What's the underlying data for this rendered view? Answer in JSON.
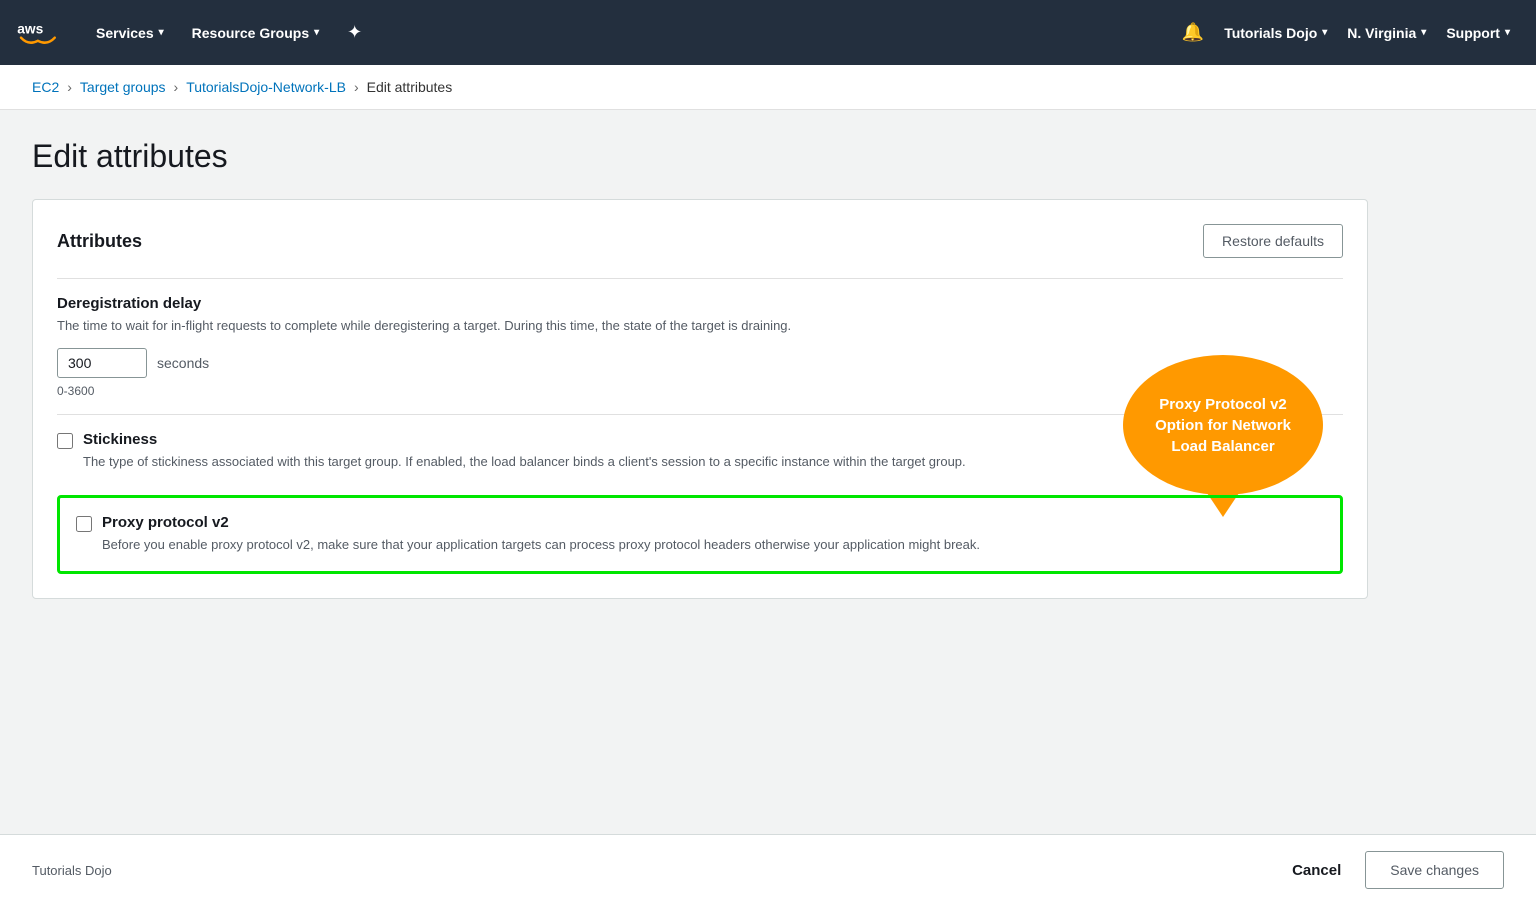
{
  "navbar": {
    "services_label": "Services",
    "resource_groups_label": "Resource Groups",
    "tutorials_dojo_label": "Tutorials Dojo",
    "region_label": "N. Virginia",
    "support_label": "Support"
  },
  "breadcrumb": {
    "ec2": "EC2",
    "target_groups": "Target groups",
    "lb_name": "TutorialsDojo-Network-LB",
    "current": "Edit attributes"
  },
  "page": {
    "title": "Edit attributes"
  },
  "card": {
    "title": "Attributes",
    "restore_defaults": "Restore defaults"
  },
  "deregistration": {
    "label": "Deregistration delay",
    "description": "The time to wait for in-flight requests to complete while deregistering a target. During this time, the state of the target is draining.",
    "value": "300",
    "unit": "seconds",
    "range": "0-3600"
  },
  "stickiness": {
    "label": "Stickiness",
    "description": "The type of stickiness associated with this target group. If enabled, the load balancer binds a client's session to a specific instance within the target group.",
    "checked": false
  },
  "proxy_protocol": {
    "label": "Proxy protocol v2",
    "description": "Before you enable proxy protocol v2, make sure that your application targets can process proxy protocol headers otherwise your application might break.",
    "checked": false,
    "bubble_text": "Proxy Protocol v2 Option for Network Load Balancer"
  },
  "footer": {
    "brand": "Tutorials Dojo",
    "cancel": "Cancel",
    "save": "Save changes"
  }
}
